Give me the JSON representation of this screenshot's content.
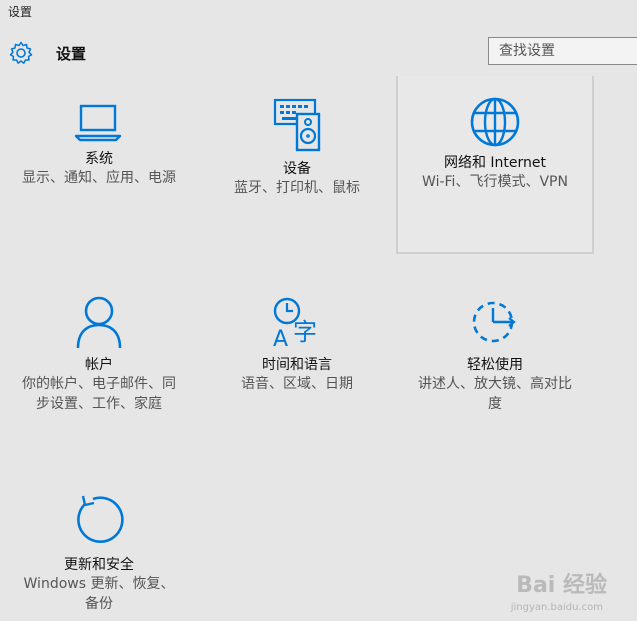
{
  "window": {
    "title": "设置"
  },
  "header": {
    "title": "设置"
  },
  "search": {
    "placeholder": "查找设置"
  },
  "tiles": [
    {
      "name": "系统",
      "desc": "显示、通知、应用、电源",
      "icon": "laptop-icon"
    },
    {
      "name": "设备",
      "desc": "蓝牙、打印机、鼠标",
      "icon": "devices-icon"
    },
    {
      "name": "网络和 Internet",
      "desc": "Wi-Fi、飞行模式、VPN",
      "icon": "globe-icon"
    },
    {
      "name": "帐户",
      "desc": "你的帐户、电子邮件、同步设置、工作、家庭",
      "icon": "person-icon"
    },
    {
      "name": "时间和语言",
      "desc": "语音、区域、日期",
      "icon": "time-language-icon"
    },
    {
      "name": "轻松使用",
      "desc": "讲述人、放大镜、高对比度",
      "icon": "ease-of-access-icon"
    },
    {
      "name": "更新和安全",
      "desc": "Windows 更新、恢复、备份",
      "icon": "update-icon"
    }
  ],
  "watermark": {
    "text": "Bai 经验",
    "sub": "jingyan.baidu.com"
  },
  "colors": {
    "accent": "#0078d7",
    "background": "#e6e6e6"
  }
}
